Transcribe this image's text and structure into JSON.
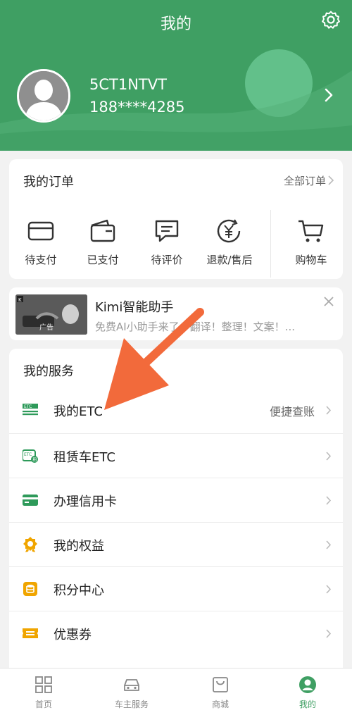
{
  "header": {
    "title": "我的",
    "username": "5CT1NTVT",
    "phone": "188****4285"
  },
  "orders": {
    "title": "我的订单",
    "all_label": "全部订单",
    "items": [
      {
        "label": "待支付",
        "icon": "card-icon"
      },
      {
        "label": "已支付",
        "icon": "wallet-icon"
      },
      {
        "label": "待评价",
        "icon": "comment-icon"
      },
      {
        "label": "退款/售后",
        "icon": "refund-icon"
      },
      {
        "label": "购物车",
        "icon": "cart-icon"
      }
    ]
  },
  "ad": {
    "title": "Kimi智能助手",
    "desc": "免费AI小助手来了：翻译！整理！文案！...",
    "thumb_text": "广告"
  },
  "services": {
    "title": "我的服务",
    "items": [
      {
        "label": "我的ETC",
        "extra": "便捷查账",
        "icon": "etc-icon"
      },
      {
        "label": "租赁车ETC",
        "extra": "",
        "icon": "rental-etc-icon"
      },
      {
        "label": "办理信用卡",
        "extra": "",
        "icon": "credit-card-icon"
      },
      {
        "label": "我的权益",
        "extra": "",
        "icon": "badge-icon"
      },
      {
        "label": "积分中心",
        "extra": "",
        "icon": "points-icon"
      },
      {
        "label": "优惠券",
        "extra": "",
        "icon": "coupon-icon"
      }
    ]
  },
  "tabs": [
    {
      "label": "首页",
      "icon": "grid-icon"
    },
    {
      "label": "车主服务",
      "icon": "car-icon"
    },
    {
      "label": "商城",
      "icon": "bag-icon"
    },
    {
      "label": "我的",
      "icon": "user-icon",
      "active": true
    }
  ],
  "colors": {
    "brand_green": "#3f9f63",
    "etc_green": "#2e9a5a",
    "orange_icon": "#f0a500",
    "annotation_arrow": "#f26a3b"
  }
}
